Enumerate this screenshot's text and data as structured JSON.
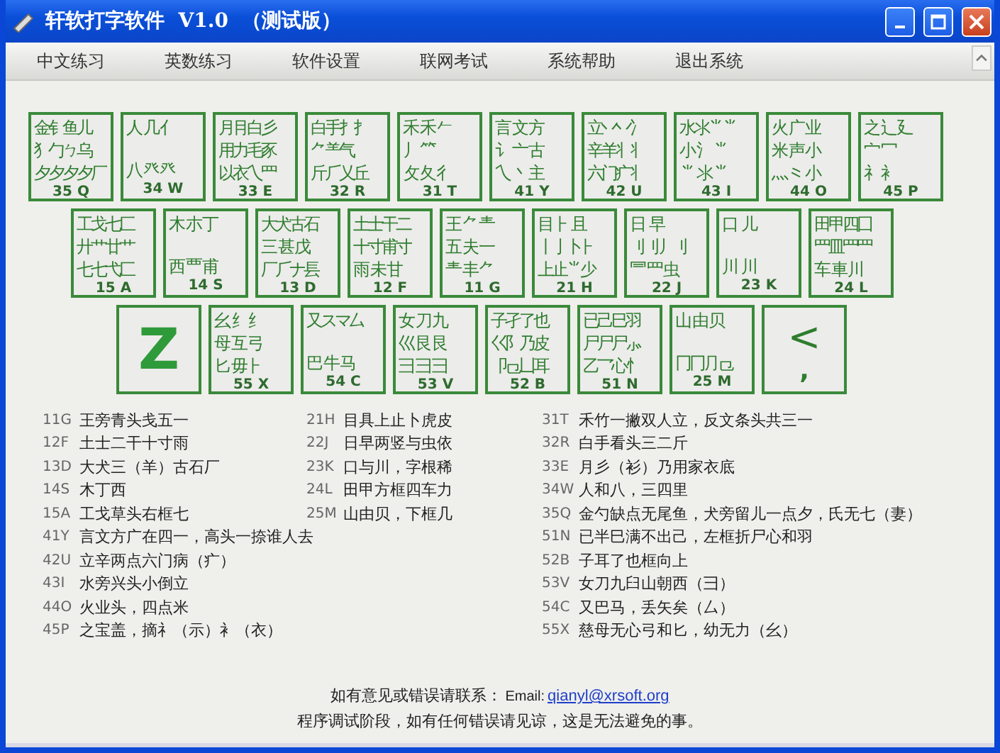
{
  "window": {
    "title": "轩软打字软件  V1.0  （测试版）"
  },
  "menu": [
    "中文练习",
    "英数练习",
    "软件设置",
    "联网考试",
    "系统帮助",
    "退出系统"
  ],
  "keyboard": {
    "rows": [
      [
        {
          "kind": "radicals",
          "top": "金钅鱼儿",
          "middle": "犭勹ㄅ乌",
          "bottom": "夕夕夕夕厂",
          "label": "35 Q"
        },
        {
          "kind": "radicals",
          "top": "人 几 亻",
          "bottom": "八 癶 癶",
          "label": "34 W"
        },
        {
          "kind": "radicals",
          "top": "月⺝白彡",
          "middle": "用力毛豕",
          "bottom": "以衣乀罒",
          "label": "33 E"
        },
        {
          "kind": "radicals",
          "top": "白手扌扌",
          "middle": "⺈⺷气",
          "bottom": "斤⺁乂丘",
          "label": "32 R"
        },
        {
          "kind": "radicals",
          "top": "禾 禾 𠂉",
          "middle": "丿 ⺮",
          "bottom": "攵 夂 彳",
          "label": "31 T"
        },
        {
          "kind": "radicals",
          "top": "言 文 方",
          "middle": "讠 亠 古",
          "bottom": "乀 丶 主",
          "label": "41 Y"
        },
        {
          "kind": "radicals",
          "top": "立丷丷冫",
          "middle": "辛羊丬丬",
          "bottom": "六门疒丬",
          "label": "42 U"
        },
        {
          "kind": "radicals",
          "top": "水氺⺌⺌",
          "middle": "小 氵 ⺌",
          "bottom": "⺌ 氺 ⺌",
          "label": "43 I"
        },
        {
          "kind": "radicals",
          "top": "火 广 业",
          "middle": "米 声 小",
          "bottom": "灬 ⺀ 小",
          "label": "44 O"
        },
        {
          "kind": "radicals",
          "top": "之 辶 廴",
          "middle": "宀 冖",
          "bottom": "礻 衤",
          "label": "45 P"
        }
      ],
      [
        {
          "kind": "radicals",
          "top": "工戈七匚",
          "middle": "廾艹廿艹",
          "bottom": "七七弋匚",
          "label": "15 A"
        },
        {
          "kind": "radicals",
          "top": "木 朩 丁",
          "bottom": "西 覀 甫",
          "label": "14 S"
        },
        {
          "kind": "radicals",
          "top": "大犬古石",
          "middle": "三 甚 戊",
          "bottom": "厂⺁ナ镸",
          "label": "13 D"
        },
        {
          "kind": "radicals",
          "top": "土士干二",
          "middle": "十寸甫寸",
          "bottom": "雨 未 甘",
          "label": "12 F"
        },
        {
          "kind": "radicals",
          "top": "王 ⺈ 龶",
          "middle": "五 夫 一",
          "bottom": "龶 丰 ⺈",
          "label": "11 G"
        },
        {
          "kind": "radicals",
          "top": "目 ⺊ 且",
          "middle": "丨亅卜⺊",
          "bottom": "上止⺌少",
          "label": "21 H"
        },
        {
          "kind": "radicals",
          "top": "日  早",
          "middle": "刂刂丿刂",
          "bottom": "⺜ 罒 虫",
          "label": "22 J"
        },
        {
          "kind": "radicals",
          "top": "口  儿",
          "bottom": "川  川",
          "label": "23 K"
        },
        {
          "kind": "radicals",
          "top": "田甲四囗",
          "middle": "罒皿罒罒",
          "bottom": "车 車 川",
          "label": "24 L"
        }
      ],
      [
        {
          "kind": "letter",
          "glyph": "Z"
        },
        {
          "kind": "radicals",
          "top": "幺 纟 纟",
          "middle": "母 互 弓",
          "bottom": "匕 毋 ⺊",
          "label": "55 X"
        },
        {
          "kind": "radicals",
          "top": "又スマ厶",
          "bottom": "巴 牛 马",
          "label": "54 C"
        },
        {
          "kind": "radicals",
          "top": "女 刀 九",
          "middle": "巛 艮 艮",
          "bottom": "彐 ⺕ ⺕",
          "label": "53 V"
        },
        {
          "kind": "radicals",
          "top": "子孑了也",
          "middle": "巜阝乃皮",
          "bottom": "卩⺋凵耳",
          "label": "52 B"
        },
        {
          "kind": "radicals",
          "top": "已己巳羽",
          "middle": "尸尸尸⺗",
          "bottom": "乙乛心忄",
          "label": "51 N"
        },
        {
          "kind": "radicals",
          "top": "山 由 贝",
          "bottom": "冂冂⺆⺋",
          "label": "25 M"
        },
        {
          "kind": "punct",
          "glyph": "<",
          "sub": ","
        }
      ]
    ]
  },
  "mnemonics": {
    "column_1": [
      {
        "code": "11G",
        "text": "王旁青头戋五一"
      },
      {
        "code": "12F",
        "text": "土士二干十寸雨"
      },
      {
        "code": "13D",
        "text": "大犬三（羊）古石厂"
      },
      {
        "code": "14S",
        "text": "木丁西"
      },
      {
        "code": "15A",
        "text": "工戈草头右框七"
      },
      {
        "code": "41Y",
        "text": "言文方广在四一，高头一捺谁人去"
      },
      {
        "code": "42U",
        "text": "立辛两点六门病（疒）"
      },
      {
        "code": "43I",
        "text": "水旁兴头小倒立"
      },
      {
        "code": "44O",
        "text": "火业头，四点米"
      },
      {
        "code": "45P",
        "text": "之宝盖，摘礻（示）衤（衣）"
      }
    ],
    "column_2": [
      {
        "code": "21H",
        "text": "目具上止卜虎皮"
      },
      {
        "code": "22J",
        "text": "日早两竖与虫依"
      },
      {
        "code": "23K",
        "text": "口与川，字根稀"
      },
      {
        "code": "24L",
        "text": "田甲方框四车力"
      },
      {
        "code": "25M",
        "text": "山由贝，下框几"
      }
    ],
    "column_3": [
      {
        "code": "31T",
        "text": "禾竹一撇双人立，反文条头共三一"
      },
      {
        "code": "32R",
        "text": "白手看头三二斤"
      },
      {
        "code": "33E",
        "text": "月彡（衫）乃用家衣底"
      },
      {
        "code": "34W",
        "text": "人和八，三四里"
      },
      {
        "code": "35Q",
        "text": "金勺缺点无尾鱼，犬旁留儿一点夕，氏无七（妻）"
      },
      {
        "code": "51N",
        "text": "已半巳满不出己，左框折尸心和羽"
      },
      {
        "code": "52B",
        "text": "子耳了也框向上"
      },
      {
        "code": "53V",
        "text": "女刀九臼山朝西（彐）"
      },
      {
        "code": "54C",
        "text": "又巴马，丢矢矣（厶）"
      },
      {
        "code": "55X",
        "text": "慈母无心弓和匕，幼无力（幺）"
      }
    ]
  },
  "footer": {
    "contact_label": "如有意见或错误请联系：",
    "email_label": "Email:",
    "email": "qianyl@xrsoft.org",
    "notice": "程序调试阶段，如有任何错误请见谅，这是无法避免的事。"
  }
}
